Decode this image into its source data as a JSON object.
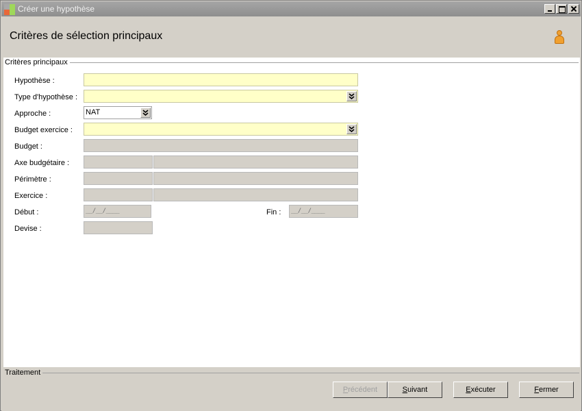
{
  "window": {
    "title": "Créer une hypothèse"
  },
  "header": {
    "title": "Critères de sélection principaux",
    "user_icon": "user-icon"
  },
  "main_group": {
    "legend": "Critères principaux",
    "fields": {
      "hypothese": {
        "label": "Hypothèse :",
        "value": ""
      },
      "type_hypothese": {
        "label": "Type d'hypothèse :",
        "value": ""
      },
      "approche": {
        "label": "Approche :",
        "value": "NAT"
      },
      "budget_exercice": {
        "label": "Budget exercice :",
        "value": ""
      },
      "budget": {
        "label": "Budget :",
        "value": ""
      },
      "axe_budgetaire": {
        "label": "Axe budgétaire :",
        "code": "",
        "desc": ""
      },
      "perimetre": {
        "label": "Périmètre :",
        "code": "",
        "desc": ""
      },
      "exercice": {
        "label": "Exercice :",
        "code": "",
        "desc": ""
      },
      "debut": {
        "label": "Début :",
        "value": "__/__/____"
      },
      "fin": {
        "label": "Fin :",
        "value": "__/__/____"
      },
      "devise": {
        "label": "Devise :",
        "value": ""
      }
    }
  },
  "footer": {
    "legend": "Traitement",
    "buttons": {
      "precedent": {
        "first": "P",
        "rest": "récédent",
        "enabled": false
      },
      "suivant": {
        "first": "S",
        "rest": "uivant",
        "enabled": true
      },
      "executer": {
        "first": "E",
        "rest": "xécuter",
        "enabled": true
      },
      "fermer": {
        "first": "F",
        "rest": "ermer",
        "enabled": true
      }
    }
  },
  "colors": {
    "required_field": "#ffffc8",
    "readonly_field": "#d4d0c8",
    "window_bg": "#d4d0c8"
  }
}
